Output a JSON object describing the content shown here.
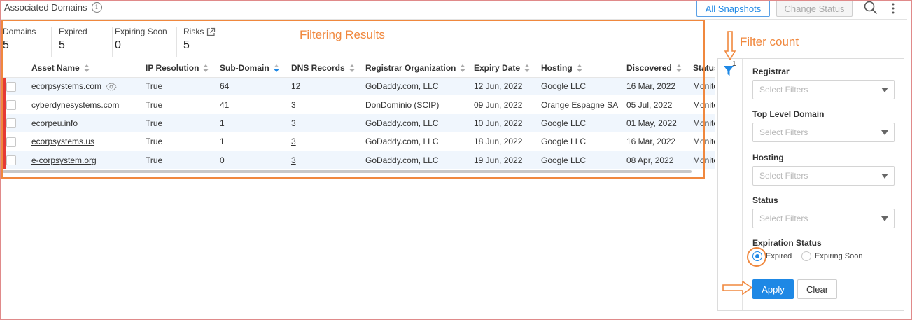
{
  "header": {
    "title": "Associated Domains",
    "all_snapshots_label": "All Snapshots",
    "change_status_label": "Change Status"
  },
  "stats": [
    {
      "label": "Domains",
      "value": "5"
    },
    {
      "label": "Expired",
      "value": "5"
    },
    {
      "label": "Expiring Soon",
      "value": "0"
    },
    {
      "label": "Risks",
      "value": "5"
    }
  ],
  "annotations": {
    "filtering_results": "Filtering Results",
    "filter_count": "Filter count"
  },
  "table": {
    "columns": [
      "Asset Name",
      "IP Resolution",
      "Sub-Domain",
      "DNS Records",
      "Registrar Organization",
      "Expiry Date",
      "Hosting",
      "Discovered",
      "Status"
    ],
    "rows": [
      {
        "asset": "ecorpsystems.com",
        "ip": "True",
        "sub": "64",
        "dns": "12",
        "registrar": "GoDaddy.com, LLC",
        "expiry": "12 Jun, 2022",
        "hosting": "Google LLC",
        "discovered": "16 Mar, 2022",
        "status": "Monitored"
      },
      {
        "asset": "cyberdynesystems.com",
        "ip": "True",
        "sub": "41",
        "dns": "3",
        "registrar": "DonDominio (SCIP)",
        "expiry": "09 Jun, 2022",
        "hosting": "Orange Espagne SA",
        "discovered": "05 Jul, 2022",
        "status": "Monitored"
      },
      {
        "asset": "ecorpeu.info",
        "ip": "True",
        "sub": "1",
        "dns": "3",
        "registrar": "GoDaddy.com, LLC",
        "expiry": "10 Jun, 2022",
        "hosting": "Google LLC",
        "discovered": "01 May, 2022",
        "status": "Monitored"
      },
      {
        "asset": "ecorpsystems.us",
        "ip": "True",
        "sub": "1",
        "dns": "3",
        "registrar": "GoDaddy.com, LLC",
        "expiry": "18 Jun, 2022",
        "hosting": "Google LLC",
        "discovered": "16 Mar, 2022",
        "status": "Monitored"
      },
      {
        "asset": "e-corpsystem.org",
        "ip": "True",
        "sub": "0",
        "dns": "3",
        "registrar": "GoDaddy.com, LLC",
        "expiry": "19 Jun, 2022",
        "hosting": "Google LLC",
        "discovered": "08 Apr, 2022",
        "status": "Monitored"
      }
    ]
  },
  "filter_panel": {
    "count": "1",
    "groups": [
      {
        "label": "Registrar",
        "placeholder": "Select Filters"
      },
      {
        "label": "Top Level Domain",
        "placeholder": "Select Filters"
      },
      {
        "label": "Hosting",
        "placeholder": "Select Filters"
      },
      {
        "label": "Status",
        "placeholder": "Select Filters"
      }
    ],
    "expiration_status": {
      "label": "Expiration Status",
      "options": [
        {
          "label": "Expired",
          "selected": true
        },
        {
          "label": "Expiring Soon",
          "selected": false
        }
      ]
    },
    "apply_label": "Apply",
    "clear_label": "Clear"
  },
  "colors": {
    "accent": "#1e88e5",
    "annotation": "#f0883e",
    "row_marker": "#e53935",
    "row_stripe": "#f0f6fd"
  }
}
